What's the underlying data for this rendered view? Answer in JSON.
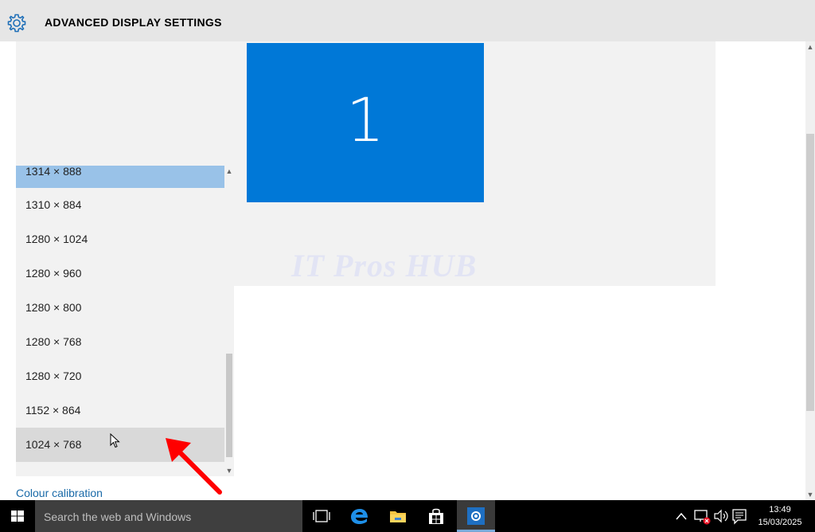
{
  "window": {
    "title": "ADVANCED DISPLAY SETTINGS"
  },
  "preview": {
    "monitor_number": "1",
    "watermark": "IT Pros HUB"
  },
  "resolution_list": {
    "items": [
      "1314 × 888",
      "1310 × 884",
      "1280 × 1024",
      "1280 × 960",
      "1280 × 800",
      "1280 × 768",
      "1280 × 720",
      "1152 × 864",
      "1024 × 768"
    ],
    "selected": "1314 × 888",
    "hovered": "1024 × 768"
  },
  "links": {
    "colour_calibration": "Colour calibration"
  },
  "taskbar": {
    "search_placeholder": "Search the web and Windows",
    "time": "13:49",
    "date": "15/03/2025"
  },
  "colors": {
    "accent": "#0078d7",
    "selected_item": "#99c2e8",
    "hover_item": "#d9d9d9",
    "link": "#1a6aa8"
  },
  "icons": {
    "title": "gear-icon",
    "start": "windows-logo-icon",
    "task_view": "task-view-icon",
    "edge": "edge-icon",
    "explorer": "file-explorer-icon",
    "store": "store-icon",
    "settings": "settings-icon",
    "tray_chevron": "chevron-up-icon",
    "network": "network-disconnected-icon",
    "volume": "volume-icon",
    "notifications": "action-center-icon"
  }
}
